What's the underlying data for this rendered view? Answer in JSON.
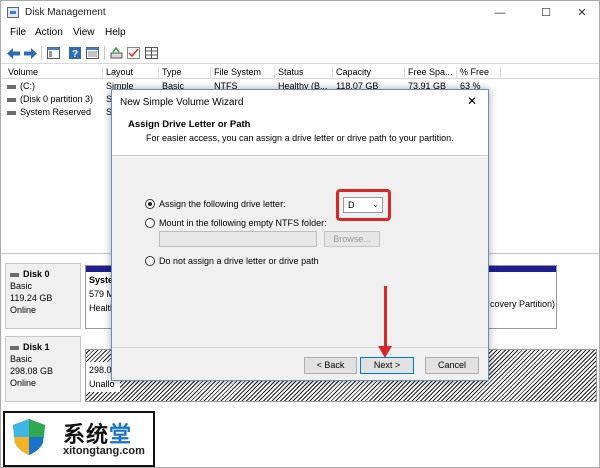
{
  "window": {
    "title": "Disk Management",
    "minimize": "—",
    "maximize": "☐",
    "close": "✕"
  },
  "menu": [
    "File",
    "Action",
    "View",
    "Help"
  ],
  "toolbar_icons": [
    "back-arrow-icon",
    "forward-arrow-icon",
    "console-tree-icon",
    "help-icon",
    "properties-icon",
    "connect-icon",
    "check-icon",
    "grid-icon"
  ],
  "volume_list": {
    "columns": [
      "Volume",
      "Layout",
      "Type",
      "File System",
      "Status",
      "Capacity",
      "Free Spa...",
      "% Free"
    ],
    "rows": [
      {
        "volume": "(C:)",
        "layout": "Simple",
        "type": "Basic",
        "fs": "NTFS",
        "status": "Healthy (B...",
        "capacity": "118.07 GB",
        "free": "73.91 GB",
        "pct": "63 %"
      },
      {
        "volume": "(Disk 0 partition 3)",
        "layout": "Si",
        "type": "",
        "fs": "",
        "status": "",
        "capacity": "",
        "free": "",
        "pct": ""
      },
      {
        "volume": "System Reserved",
        "layout": "Si",
        "type": "",
        "fs": "",
        "status": "",
        "capacity": "",
        "free": "",
        "pct": ""
      }
    ]
  },
  "disks": [
    {
      "name": "Disk 0",
      "kind": "Basic",
      "size": "119.24 GB",
      "state": "Online",
      "first_partition": {
        "line1": "Syster",
        "line2": "579 M",
        "line3": "Healtl"
      },
      "right_text": "covery Partition)"
    },
    {
      "name": "Disk 1",
      "kind": "Basic",
      "size": "298.08 GB",
      "state": "Online",
      "first_partition": {
        "line1": "298.08",
        "line2": "Unallo"
      }
    }
  ],
  "dialog": {
    "title": "New Simple Volume Wizard",
    "close": "✕",
    "heading": "Assign Drive Letter or Path",
    "subheading": "For easier access, you can assign a drive letter or drive path to your partition.",
    "option_letter": "Assign the following drive letter:",
    "option_folder": "Mount in the following empty NTFS folder:",
    "option_none": "Do not assign a drive letter or drive path",
    "selected_option": "letter",
    "drive_letter": "D",
    "browse": "Browse...",
    "back": "< Back",
    "next": "Next >",
    "cancel": "Cancel"
  },
  "watermark": {
    "cn_text": "系统",
    "cn_accent": "堂",
    "url": "xitongtang.com"
  },
  "colors": {
    "highlight": "#d62828",
    "partition_bar": "#1f1f8f",
    "accent_blue": "#0078d7"
  }
}
